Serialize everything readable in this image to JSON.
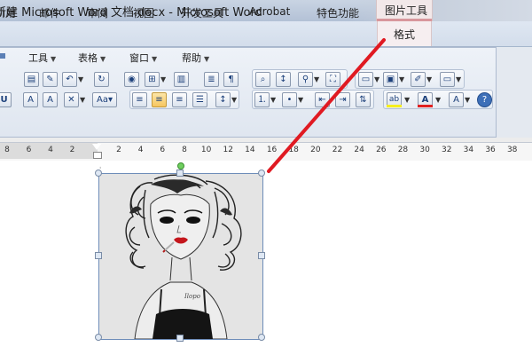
{
  "window": {
    "title": "新建 Microsoft Word 文档.docx - Microsoft Word",
    "picture_tools_label": "图片工具"
  },
  "tabs": [
    {
      "label": "引用"
    },
    {
      "label": "邮件"
    },
    {
      "label": "审阅"
    },
    {
      "label": "视图"
    },
    {
      "label": "开发工具"
    },
    {
      "label": "Acrobat"
    },
    {
      "label": "特色功能"
    },
    {
      "label": "格式"
    }
  ],
  "menu": [
    {
      "label": "工具"
    },
    {
      "label": "表格"
    },
    {
      "label": "窗口"
    },
    {
      "label": "帮助"
    }
  ],
  "toolbar": {
    "font_size_label": "Aa",
    "highlight_label": "ab",
    "font_color_label": "A",
    "help_label": "?",
    "colors": {
      "highlight": "#f6ef1e",
      "font_color": "#e02020"
    }
  },
  "ruler": {
    "ticks": [
      "8",
      "6",
      "4",
      "2",
      "2",
      "4",
      "6",
      "8",
      "10",
      "12",
      "14",
      "16",
      "18",
      "20",
      "22",
      "24",
      "26",
      "28",
      "30",
      "32",
      "34",
      "36",
      "38"
    ]
  },
  "annotation": {
    "color": "#e01a22"
  },
  "document": {
    "picture": {
      "description_icon": "woman-sketch-image"
    }
  }
}
